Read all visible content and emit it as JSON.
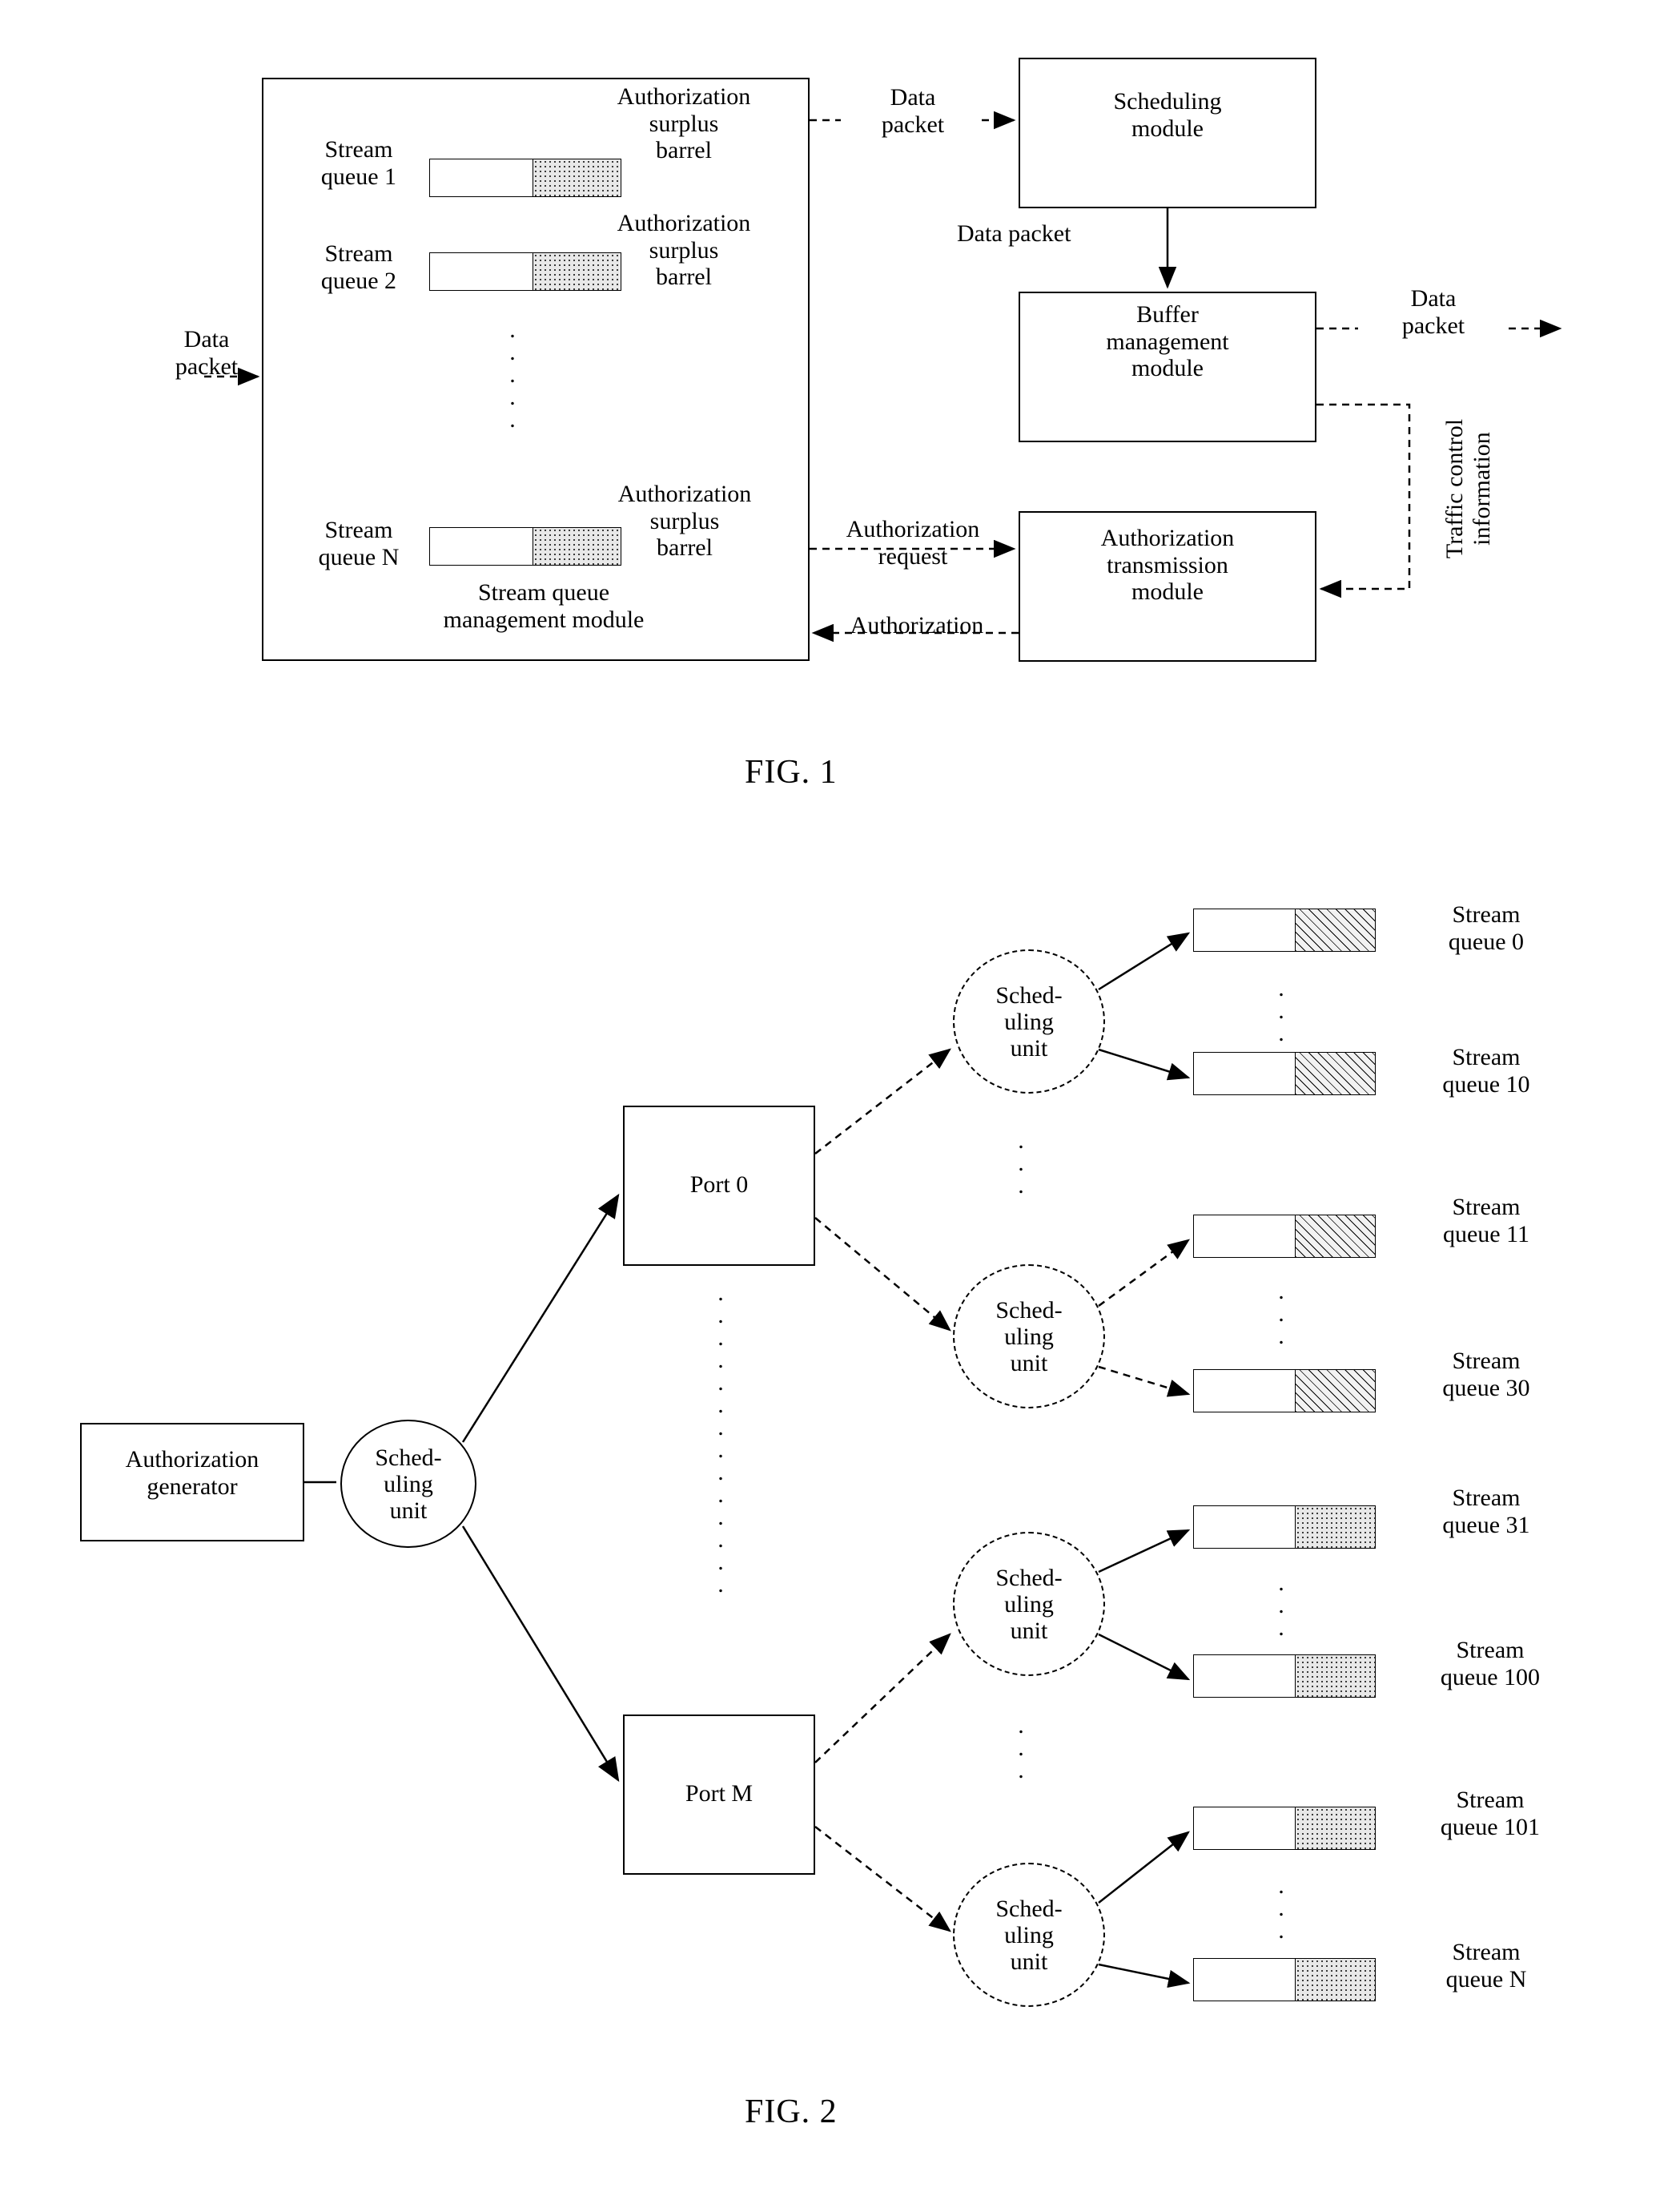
{
  "figures": [
    {
      "id": "fig1",
      "caption": "FIG. 1",
      "blocks": {
        "stream_queue_management_module": "Stream queue\nmanagement module",
        "scheduling_module": "Scheduling\nmodule",
        "buffer_management_module": "Buffer\nmanagement\nmodule",
        "authorization_transmission_module": "Authorization\ntransmission\nmodule"
      },
      "queues": [
        {
          "label": "Stream\nqueue 1",
          "barrel": "Authorization\nsurplus\nbarrel"
        },
        {
          "label": "Stream\nqueue 2",
          "barrel": "Authorization\nsurplus\nbarrel"
        },
        {
          "label": "Stream\nqueue N",
          "barrel": "Authorization\nsurplus\nbarrel"
        }
      ],
      "labels": {
        "data_packet_in": "Data\npacket",
        "data_packet_to_scheduling": "Data\npacket",
        "data_packet_to_buffer": "Data packet",
        "data_packet_out": "Data\npacket",
        "authorization_request": "Authorization\nrequest",
        "authorization": "Authorization",
        "traffic_control_information": "Traffic control\ninformation"
      }
    },
    {
      "id": "fig2",
      "caption": "FIG. 2",
      "blocks": {
        "authorization_generator": "Authorization\ngenerator",
        "port_0": "Port 0",
        "port_m": "Port M"
      },
      "scheduling_units": [
        {
          "id": "root",
          "label": "Sched-\nuling\nunit"
        },
        {
          "id": "p0-a",
          "label": "Sched-\nuling\nunit"
        },
        {
          "id": "p0-b",
          "label": "Sched-\nuling\nunit"
        },
        {
          "id": "pm-a",
          "label": "Sched-\nuling\nunit"
        },
        {
          "id": "pm-b",
          "label": "Sched-\nuling\nunit"
        }
      ],
      "queues": [
        {
          "label": "Stream\nqueue 0"
        },
        {
          "label": "Stream\nqueue 10"
        },
        {
          "label": "Stream\nqueue 11"
        },
        {
          "label": "Stream\nqueue 30"
        },
        {
          "label": "Stream\nqueue 31"
        },
        {
          "label": "Stream\nqueue 100"
        },
        {
          "label": "Stream\nqueue 101"
        },
        {
          "label": "Stream\nqueue N"
        }
      ]
    }
  ]
}
